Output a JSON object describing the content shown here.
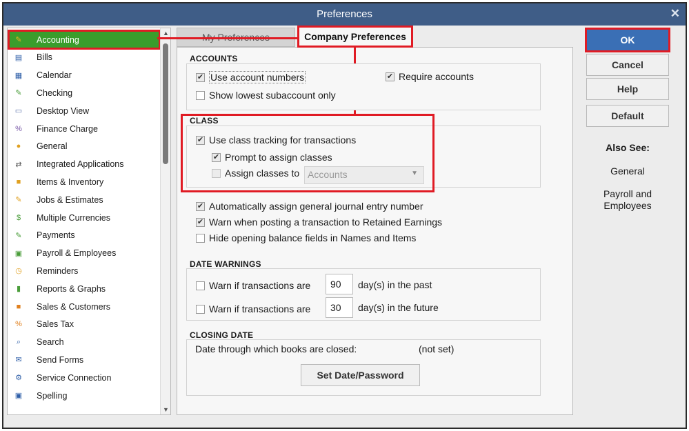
{
  "window": {
    "title": "Preferences",
    "close_glyph": "✕"
  },
  "sidebar": {
    "items": [
      {
        "label": "Accounting",
        "icon": "accounting-icon",
        "color": "#f2b01e",
        "glyph": "✎",
        "selected": true
      },
      {
        "label": "Bills",
        "icon": "bills-icon",
        "color": "#2f5fa8",
        "glyph": "▤"
      },
      {
        "label": "Calendar",
        "icon": "calendar-icon",
        "color": "#2f5fa8",
        "glyph": "▦"
      },
      {
        "label": "Checking",
        "icon": "checking-icon",
        "color": "#4a9d3a",
        "glyph": "✎"
      },
      {
        "label": "Desktop View",
        "icon": "desktop-view-icon",
        "color": "#5a6fa8",
        "glyph": "▭"
      },
      {
        "label": "Finance Charge",
        "icon": "finance-charge-icon",
        "color": "#7a5aa8",
        "glyph": "%"
      },
      {
        "label": "General",
        "icon": "general-icon",
        "color": "#e0a020",
        "glyph": "●"
      },
      {
        "label": "Integrated Applications",
        "icon": "integrated-applications-icon",
        "color": "#555555",
        "glyph": "⇄"
      },
      {
        "label": "Items & Inventory",
        "icon": "items-inventory-icon",
        "color": "#e0a020",
        "glyph": "■"
      },
      {
        "label": "Jobs & Estimates",
        "icon": "jobs-estimates-icon",
        "color": "#e0a020",
        "glyph": "✎"
      },
      {
        "label": "Multiple Currencies",
        "icon": "multiple-currencies-icon",
        "color": "#4a9d3a",
        "glyph": "$"
      },
      {
        "label": "Payments",
        "icon": "payments-icon",
        "color": "#4a9d3a",
        "glyph": "✎"
      },
      {
        "label": "Payroll & Employees",
        "icon": "payroll-employees-icon",
        "color": "#4a9d3a",
        "glyph": "▣"
      },
      {
        "label": "Reminders",
        "icon": "reminders-icon",
        "color": "#e0a020",
        "glyph": "◷"
      },
      {
        "label": "Reports & Graphs",
        "icon": "reports-graphs-icon",
        "color": "#4a9d3a",
        "glyph": "▮"
      },
      {
        "label": "Sales & Customers",
        "icon": "sales-customers-icon",
        "color": "#e0801e",
        "glyph": "■"
      },
      {
        "label": "Sales Tax",
        "icon": "sales-tax-icon",
        "color": "#e0801e",
        "glyph": "%"
      },
      {
        "label": "Search",
        "icon": "search-icon",
        "color": "#2f5fa8",
        "glyph": "⌕"
      },
      {
        "label": "Send Forms",
        "icon": "send-forms-icon",
        "color": "#2f5fa8",
        "glyph": "✉"
      },
      {
        "label": "Service Connection",
        "icon": "service-connection-icon",
        "color": "#2f5fa8",
        "glyph": "⚙"
      },
      {
        "label": "Spelling",
        "icon": "spelling-icon",
        "color": "#2f5fa8",
        "glyph": "▣"
      }
    ]
  },
  "tabs": {
    "my": "My Preferences",
    "company": "Company Preferences"
  },
  "accounts": {
    "title": "ACCOUNTS",
    "use_account_numbers": {
      "label": "Use account numbers",
      "checked": true
    },
    "show_lowest_subaccount": {
      "label": "Show lowest subaccount only",
      "checked": false
    },
    "require_accounts": {
      "label": "Require accounts",
      "checked": true
    }
  },
  "class": {
    "title": "CLASS",
    "use_class_tracking": {
      "label": "Use class tracking for transactions",
      "checked": true
    },
    "prompt_assign": {
      "label": "Prompt to assign classes",
      "checked": true
    },
    "assign_classes_to": {
      "label": "Assign classes to",
      "checked": false,
      "value": "Accounts"
    }
  },
  "general_options": {
    "auto_journal": {
      "label": "Automatically assign general journal entry number",
      "checked": true
    },
    "warn_retained": {
      "label": "Warn when posting a transaction to Retained Earnings",
      "checked": true
    },
    "hide_opening": {
      "label": "Hide opening balance fields in Names and Items",
      "checked": false
    }
  },
  "date_warnings": {
    "title": "DATE WARNINGS",
    "past": {
      "label": "Warn if transactions are",
      "days": "90",
      "suffix": "day(s) in the past",
      "checked": false
    },
    "future": {
      "label": "Warn if transactions are",
      "days": "30",
      "suffix": "day(s) in the future",
      "checked": false
    }
  },
  "closing_date": {
    "title": "CLOSING DATE",
    "label": "Date through which books are closed:",
    "value": "(not set)",
    "button": "Set Date/Password"
  },
  "buttons": {
    "ok": "OK",
    "cancel": "Cancel",
    "help": "Help",
    "default": "Default"
  },
  "also_see": {
    "title": "Also See:",
    "general": "General",
    "payroll": "Payroll and Employees"
  },
  "colors": {
    "titlebar": "#3f5d87",
    "selected": "#3a9d2c",
    "ok": "#3a6fb5",
    "highlight": "#e01b24"
  }
}
